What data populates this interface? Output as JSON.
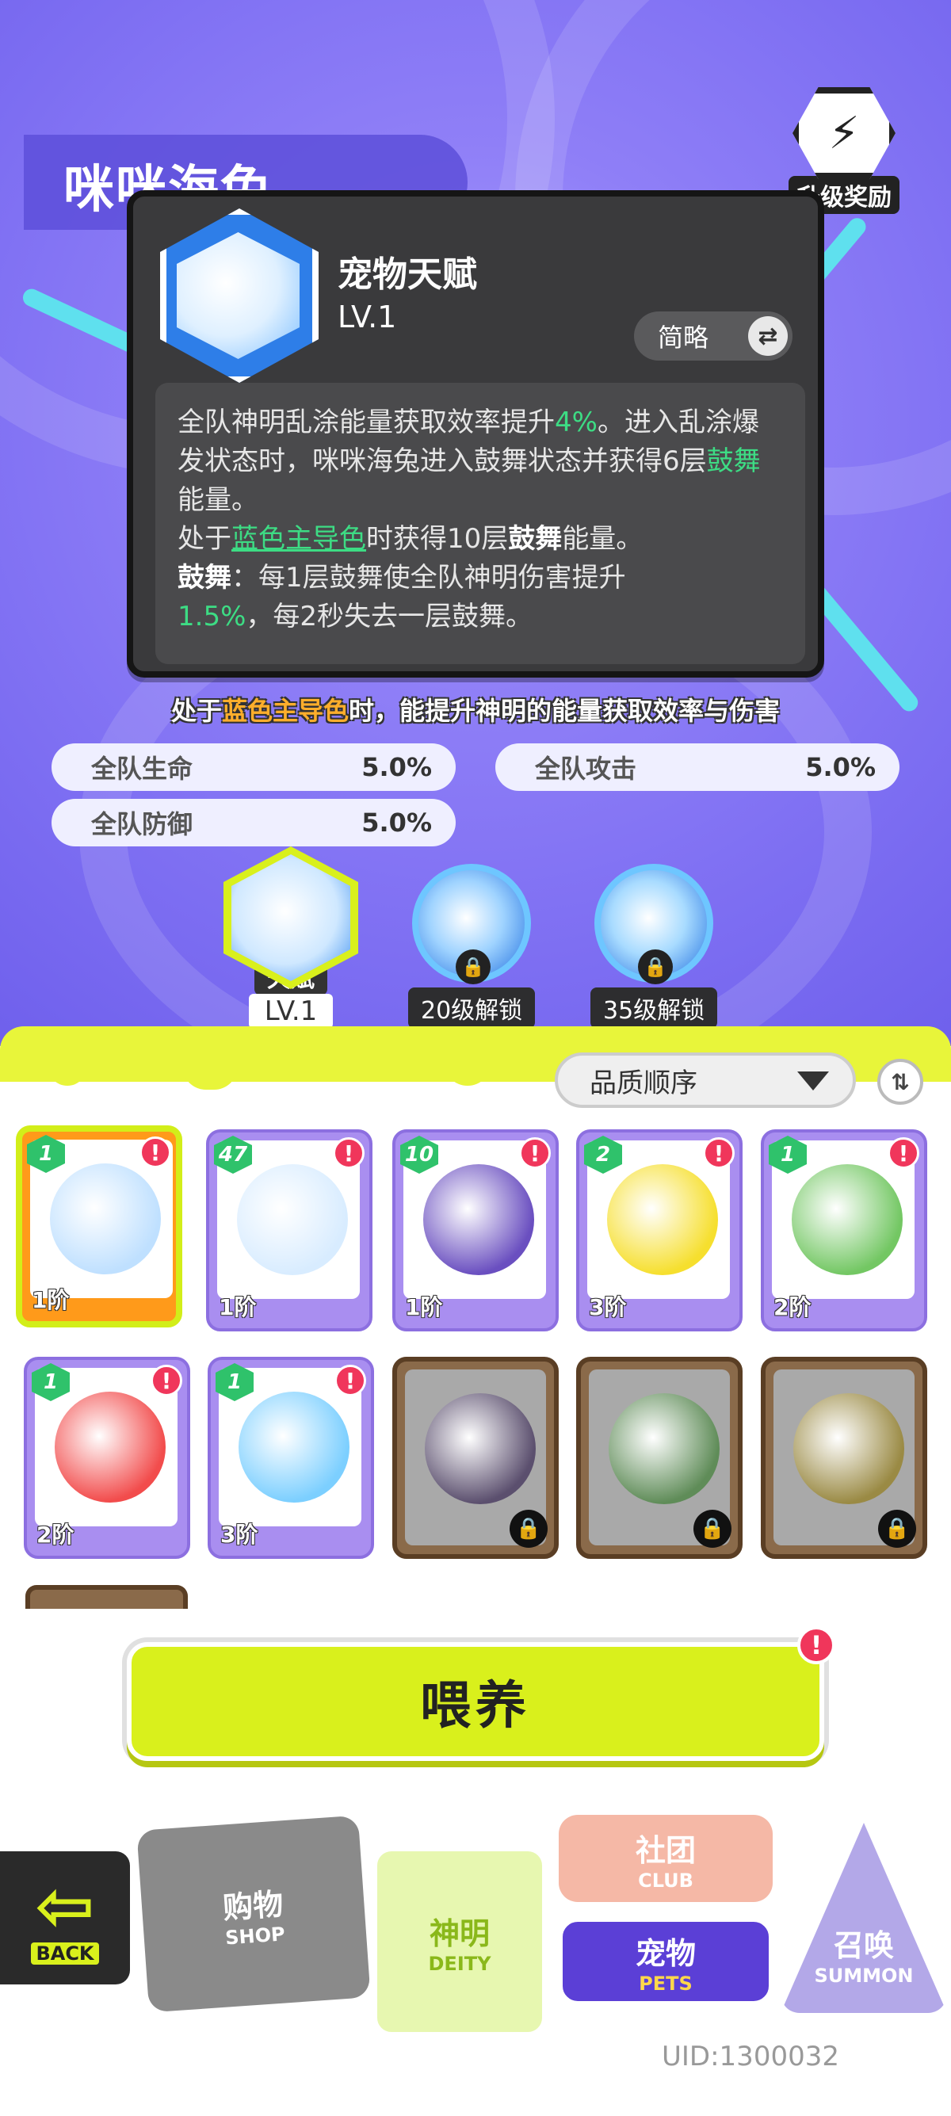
{
  "pet": {
    "name": "咪咪海兔",
    "reward_label": "升级奖励"
  },
  "talent": {
    "title": "宠物天赋",
    "level": "LV.1",
    "summary_label": "简略",
    "desc_l1_a": "全队神明乱涂能量获取效率提升",
    "desc_l1_pct": "4%",
    "desc_l1_b": "。进入乱涂爆发状态时，咪咪海兔进入鼓舞状态并获得6层",
    "desc_l1_kw": "鼓舞",
    "desc_l1_c": "能量。",
    "desc_l2_a": "处于",
    "desc_l2_kw": "蓝色主导色",
    "desc_l2_b": "时获得10层",
    "desc_l2_kw2": "鼓舞",
    "desc_l2_c": "能量。",
    "desc_l3_kw": "鼓舞",
    "desc_l3_a": "：每1层鼓舞使全队神明伤害提升",
    "desc_l3_pct": "1.5%",
    "desc_l3_b": "，每2秒失去一层鼓舞。"
  },
  "banner": {
    "a": "处于",
    "kw": "蓝色主导色",
    "b": "时，能提升神明的能量获取效率与伤害"
  },
  "stats": [
    {
      "label": "全队生命",
      "value": "5.0%"
    },
    {
      "label": "全队攻击",
      "value": "5.0%"
    },
    {
      "label": "全队防御",
      "value": "5.0%"
    }
  ],
  "skills": [
    {
      "tag": "天赋",
      "level": "LV.1"
    },
    {
      "unlock": "20级解锁"
    },
    {
      "unlock": "35级解锁"
    }
  ],
  "sort": {
    "label": "品质顺序",
    "order_icon": "⇅"
  },
  "cards": [
    {
      "count": "1",
      "rank": "1阶",
      "color": "#bfe0ff"
    },
    {
      "count": "47",
      "rank": "1阶",
      "color": "#d8ecff"
    },
    {
      "count": "10",
      "rank": "1阶",
      "color": "#6a4fc0"
    },
    {
      "count": "2",
      "rank": "3阶",
      "color": "#f6df2e"
    },
    {
      "count": "1",
      "rank": "2阶",
      "color": "#73c763"
    },
    {
      "count": "1",
      "rank": "2阶",
      "color": "#f24c4c"
    },
    {
      "count": "1",
      "rank": "3阶",
      "color": "#7ccfff"
    },
    {
      "color": "#5b4f6e"
    },
    {
      "color": "#5f8c58"
    },
    {
      "color": "#9a8a44"
    }
  ],
  "alert_mark": "!",
  "feed_label": "喂养",
  "nav": {
    "back": "BACK",
    "shop_zh": "购物",
    "shop_en": "SHOP",
    "deity_zh": "神明",
    "deity_en": "DEITY",
    "club_zh": "社团",
    "club_en": "CLUB",
    "pets_zh": "宠物",
    "pets_en": "PETS",
    "summon_zh": "召唤",
    "summon_en": "SUMMON"
  },
  "uid": "UID:1300032"
}
